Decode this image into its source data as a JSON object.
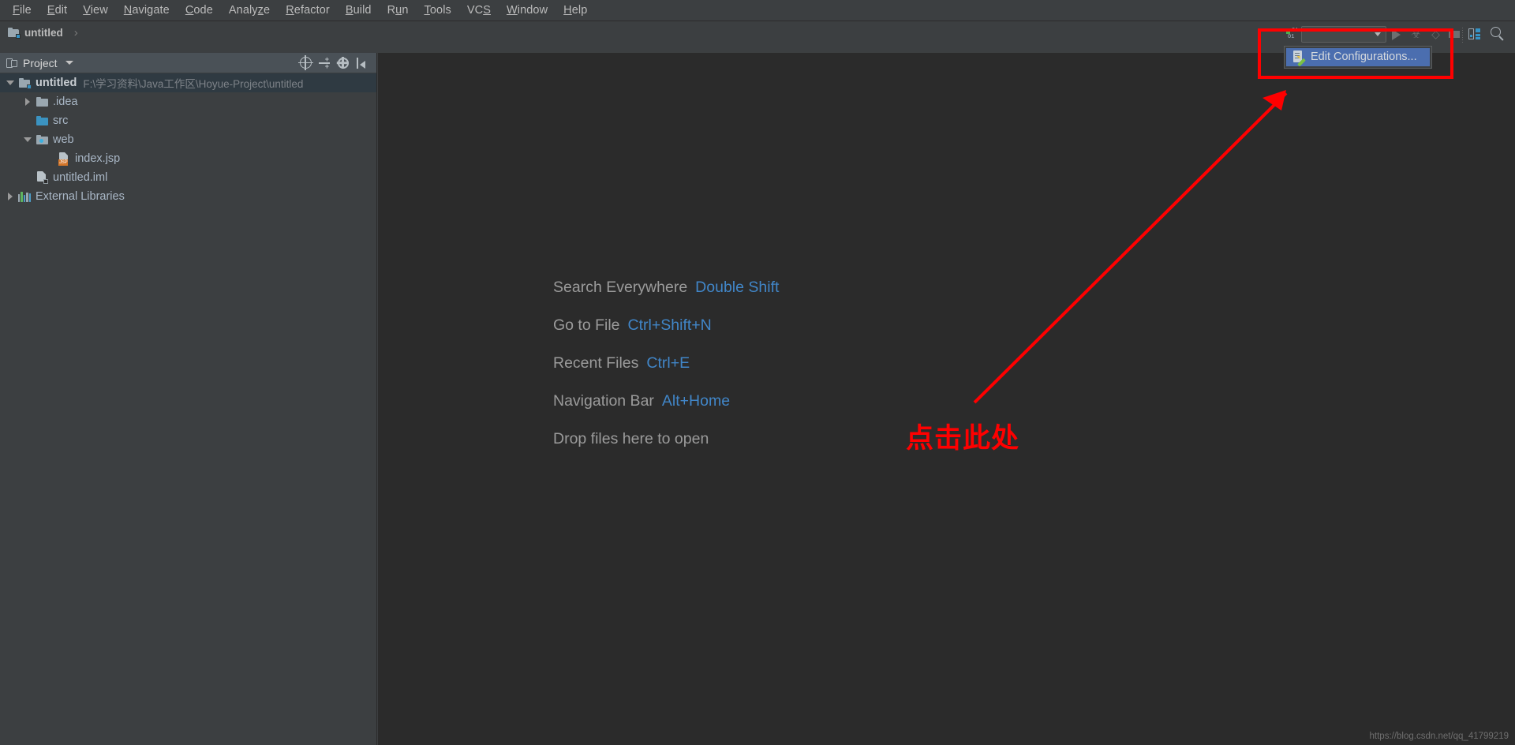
{
  "window": {
    "title": "untitled",
    "watermark": "https://blog.csdn.net/qq_41799219"
  },
  "menubar": {
    "items": [
      {
        "label": "File",
        "mnemonic": "F"
      },
      {
        "label": "Edit",
        "mnemonic": "E"
      },
      {
        "label": "View",
        "mnemonic": "V"
      },
      {
        "label": "Navigate",
        "mnemonic": "N"
      },
      {
        "label": "Code",
        "mnemonic": "C"
      },
      {
        "label": "Analyze",
        "mnemonic": "z"
      },
      {
        "label": "Refactor",
        "mnemonic": "R"
      },
      {
        "label": "Build",
        "mnemonic": "B"
      },
      {
        "label": "Run",
        "mnemonic": "u"
      },
      {
        "label": "Tools",
        "mnemonic": "T"
      },
      {
        "label": "VCS",
        "mnemonic": "S"
      },
      {
        "label": "Window",
        "mnemonic": "W"
      },
      {
        "label": "Help",
        "mnemonic": "H"
      }
    ]
  },
  "breadcrumb": {
    "project_label": "untitled",
    "separator": "›",
    "icon": "module-icon"
  },
  "run_toolbar": {
    "build_icon": "build-binary-icon",
    "config_combo_value": "",
    "config_combo_caret": "chevron-down-icon",
    "run_icon": "run-play-icon",
    "debug_icon": "debug-bug-icon",
    "coverage_icon": "run-coverage-icon",
    "layout_icon": "restore-layout-icon",
    "search_icon": "search-everywhere-icon"
  },
  "config_popup": {
    "item_label": "Edit Configurations...",
    "item_icon": "edit-configurations-icon",
    "highlight_color": "#4b6eaf"
  },
  "annotation": {
    "note_text": "点击此处",
    "color": "#ff0000",
    "rect_label": "highlight-rectangle",
    "arrow_label": "pointer-arrow"
  },
  "project_panel": {
    "header": {
      "title": "Project",
      "icon": "project-view-icon",
      "caret": "chevron-down-icon",
      "buttons": [
        {
          "name": "scroll-from-source-icon"
        },
        {
          "name": "collapse-all-icon"
        },
        {
          "name": "settings-gear-icon"
        },
        {
          "name": "hide-panel-icon"
        }
      ]
    },
    "tree": [
      {
        "label": "untitled",
        "path": "F:\\学习资料\\Java工作区\\Hoyue-Project\\untitled",
        "icon": "module-icon",
        "arrow": "expanded",
        "indent": 0,
        "bold": true,
        "selected": true
      },
      {
        "label": ".idea",
        "path": "",
        "icon": "folder-gray-icon",
        "arrow": "collapsed",
        "indent": 1,
        "bold": false,
        "selected": false
      },
      {
        "label": "src",
        "path": "",
        "icon": "folder-blue-icon",
        "arrow": "none",
        "indent": 1,
        "bold": false,
        "selected": false
      },
      {
        "label": "web",
        "path": "",
        "icon": "folder-web-icon",
        "arrow": "expanded",
        "indent": 1,
        "bold": false,
        "selected": false
      },
      {
        "label": "index.jsp",
        "path": "",
        "icon": "jsp-file-icon",
        "arrow": "none",
        "indent": 2,
        "bold": false,
        "selected": false
      },
      {
        "label": "untitled.iml",
        "path": "",
        "icon": "iml-file-icon",
        "arrow": "none",
        "indent": 1,
        "bold": false,
        "selected": false
      },
      {
        "label": "External Libraries",
        "path": "",
        "icon": "libraries-icon",
        "arrow": "collapsed",
        "indent": 0,
        "bold": false,
        "selected": false
      }
    ]
  },
  "editor": {
    "welcome_rows": [
      {
        "action": "Search Everywhere",
        "shortcut": "Double Shift"
      },
      {
        "action": "Go to File",
        "shortcut": "Ctrl+Shift+N"
      },
      {
        "action": "Recent Files",
        "shortcut": "Ctrl+E"
      },
      {
        "action": "Navigation Bar",
        "shortcut": "Alt+Home"
      },
      {
        "action": "Drop files here to open",
        "shortcut": ""
      }
    ]
  },
  "colors": {
    "background": "#3c3f41",
    "editor_background": "#2b2b2b",
    "accent_blue": "#4186c8",
    "selection_blue": "#4b6eaf",
    "text": "#a9b7c6",
    "annotation_red": "#ff0000"
  }
}
